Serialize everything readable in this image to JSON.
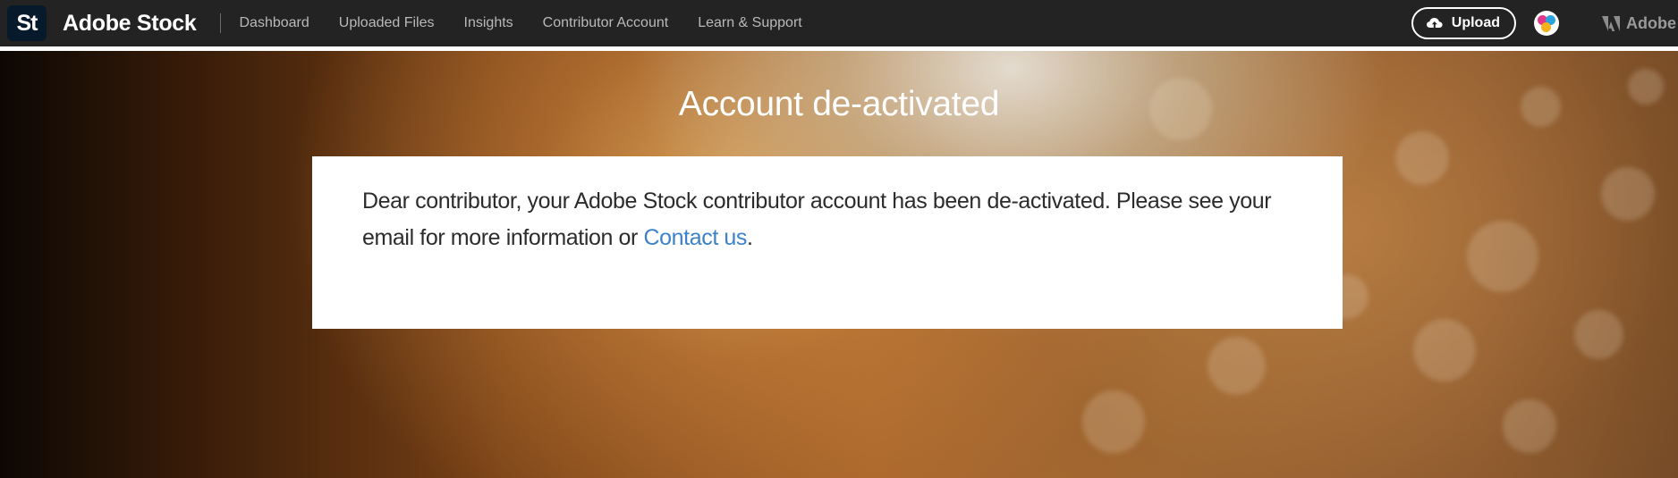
{
  "header": {
    "logo_text": "St",
    "brand_name": "Adobe Stock",
    "nav": [
      {
        "label": "Dashboard"
      },
      {
        "label": "Uploaded Files"
      },
      {
        "label": "Insights"
      },
      {
        "label": "Contributor Account"
      },
      {
        "label": "Learn & Support"
      }
    ],
    "upload_label": "Upload",
    "upload_icon": "cloud-upload-icon",
    "avatar_icon": "user-avatar",
    "adobe_label": "Adobe",
    "adobe_icon": "adobe-logo-icon"
  },
  "hero": {
    "title": "Account de-activated"
  },
  "message": {
    "text": "Dear contributor, your Adobe Stock contributor account has been de-activated. Please see your email for more information or ",
    "link_label": "Contact us",
    "suffix": "."
  },
  "colors": {
    "header_bg": "#232323",
    "link": "#3b82c8",
    "logo_tile": "#061a2b"
  }
}
